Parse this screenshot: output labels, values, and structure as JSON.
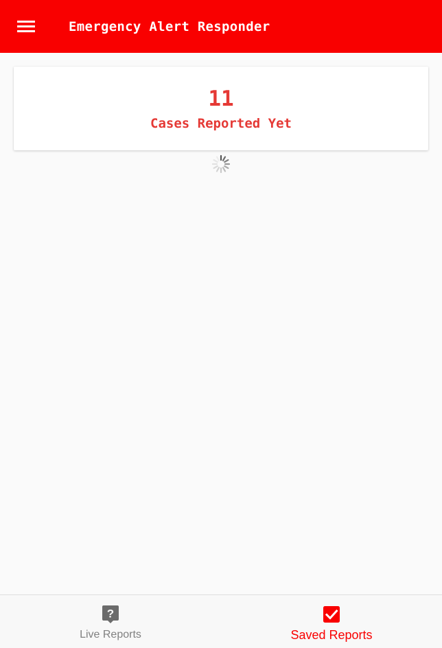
{
  "header": {
    "title": "Emergency Alert Responder",
    "menu_icon": "menu-icon"
  },
  "summary": {
    "count": "11",
    "label": "Cases Reported Yet"
  },
  "loading": {
    "icon": "spinner-icon"
  },
  "tabs": [
    {
      "label": "Live Reports",
      "icon": "live-help-icon",
      "active": false
    },
    {
      "label": "Saved Reports",
      "icon": "checkbox-checked-icon",
      "active": true
    }
  ],
  "colors": {
    "brand": "#f90000",
    "accent_text": "#e53935",
    "inactive_tab": "#808080",
    "background": "#fafafa"
  }
}
